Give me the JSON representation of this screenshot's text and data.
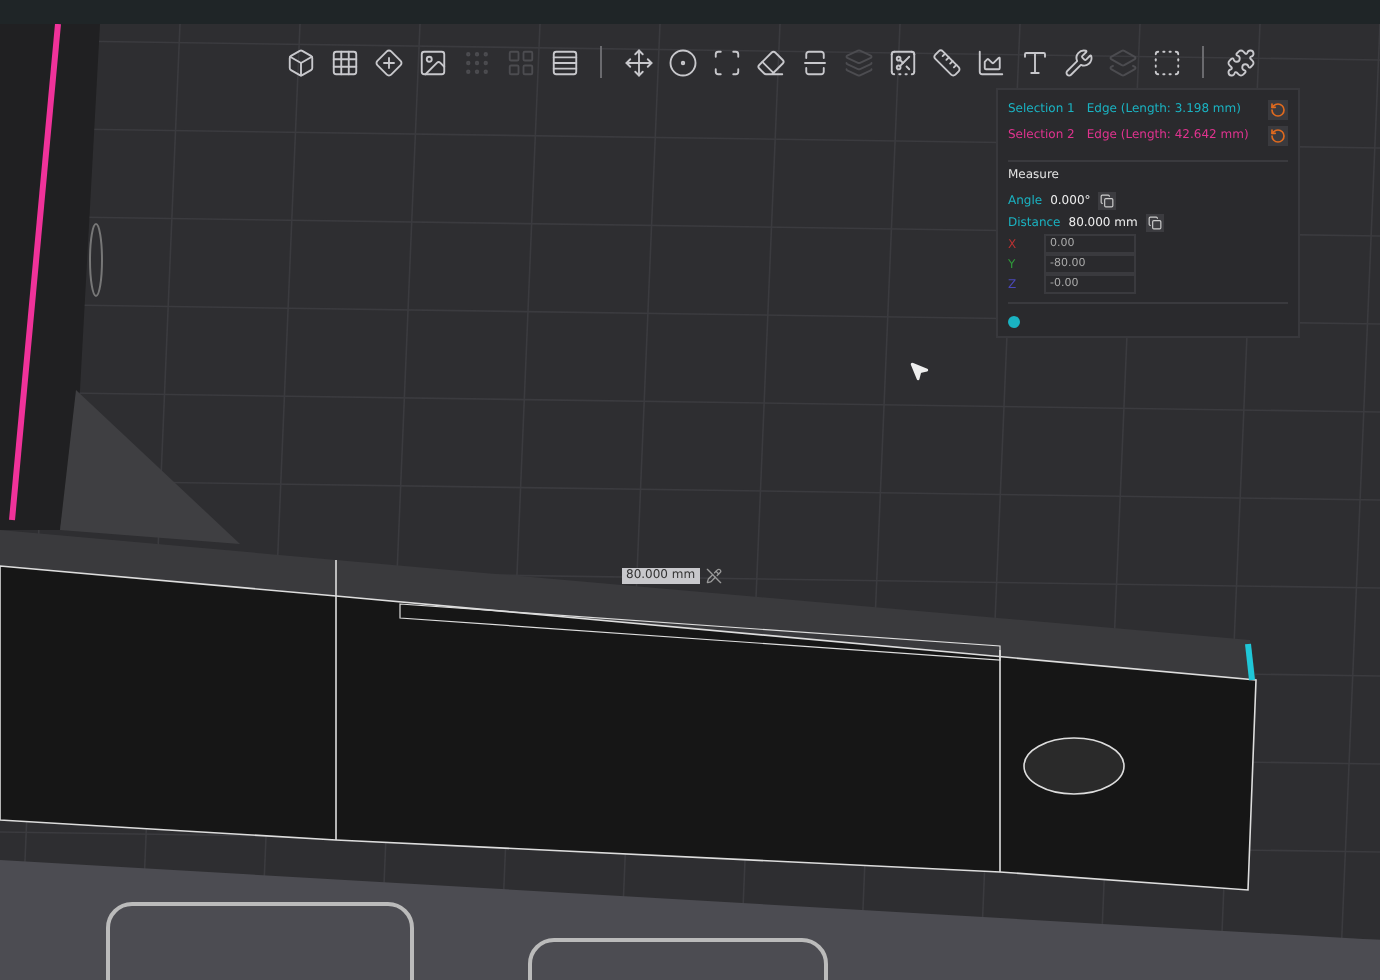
{
  "toolbar": {
    "groups": [
      [
        {
          "kind": "cube",
          "disabled": false
        },
        {
          "kind": "grid",
          "disabled": false
        },
        {
          "kind": "diamond",
          "disabled": false
        },
        {
          "kind": "picture",
          "disabled": false
        },
        {
          "kind": "dots",
          "disabled": true
        },
        {
          "kind": "squares",
          "disabled": true
        },
        {
          "kind": "rows",
          "disabled": false
        }
      ],
      [
        {
          "kind": "move",
          "disabled": false
        },
        {
          "kind": "circle",
          "disabled": false
        },
        {
          "kind": "frame",
          "disabled": false
        },
        {
          "kind": "eraser",
          "disabled": false
        },
        {
          "kind": "split",
          "disabled": false
        },
        {
          "kind": "layers",
          "disabled": true
        },
        {
          "kind": "corner",
          "disabled": false
        },
        {
          "kind": "ruler",
          "disabled": false
        },
        {
          "kind": "chart",
          "disabled": false
        },
        {
          "kind": "text",
          "disabled": false
        },
        {
          "kind": "tool",
          "disabled": false
        },
        {
          "kind": "stack",
          "disabled": true
        },
        {
          "kind": "node",
          "disabled": false
        }
      ],
      [
        {
          "kind": "puzzle",
          "disabled": false
        }
      ]
    ]
  },
  "measure_panel": {
    "selections": [
      {
        "label": "Selection 1",
        "value": "Edge (Length: 3.198 mm)",
        "color": "#1ab3c2"
      },
      {
        "label": "Selection 2",
        "value": "Edge (Length: 42.642 mm)",
        "color": "#e0338f"
      }
    ],
    "title": "Measure",
    "rows": [
      {
        "label": "Angle",
        "value": "0.000°"
      },
      {
        "label": "Distance",
        "value": "80.000 mm"
      }
    ],
    "coords": [
      {
        "axis": "X",
        "value": "0.00",
        "color": "#b83232"
      },
      {
        "axis": "Y",
        "value": "-80.00",
        "color": "#2f9a3a"
      },
      {
        "axis": "Z",
        "value": "-0.00",
        "color": "#4a48b8"
      }
    ]
  },
  "dimension_label": "80.000 mm"
}
